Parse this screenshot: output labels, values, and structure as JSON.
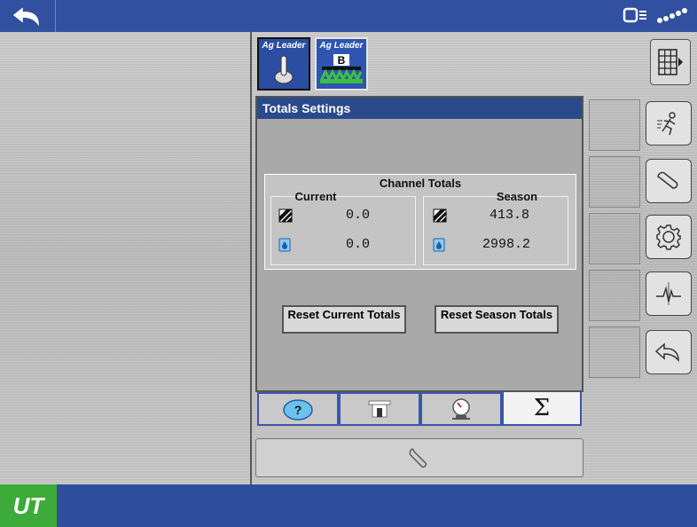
{
  "app_tabs": [
    {
      "brand": "Ag Leader",
      "icon": "joystick-icon"
    },
    {
      "brand": "Ag Leader",
      "icon": "sprayer-icon",
      "badge": "B"
    }
  ],
  "window": {
    "title": "Totals Settings",
    "channel_totals": {
      "heading": "Channel Totals",
      "current": {
        "label": "Current",
        "area": "0.0",
        "volume": "0.0"
      },
      "season": {
        "label": "Season",
        "area": "413.8",
        "volume": "2998.2"
      }
    },
    "buttons": {
      "reset_current": "Reset Current Totals",
      "reset_season": "Reset Season Totals"
    }
  },
  "bottom_tabs": [
    {
      "icon": "help-icon"
    },
    {
      "icon": "tank-icon"
    },
    {
      "icon": "gauge-icon"
    },
    {
      "icon": "sigma-icon",
      "label": "Σ",
      "selected": true
    }
  ],
  "side_buttons": [
    "run-icon",
    "wrench-icon",
    "gear-icon",
    "diagnostics-icon",
    "back-icon"
  ],
  "footer": {
    "logo": "UT"
  },
  "colors": {
    "topbar": "#3150a0",
    "title_bar": "#2a4a8c",
    "logo_green": "#3cab39"
  }
}
